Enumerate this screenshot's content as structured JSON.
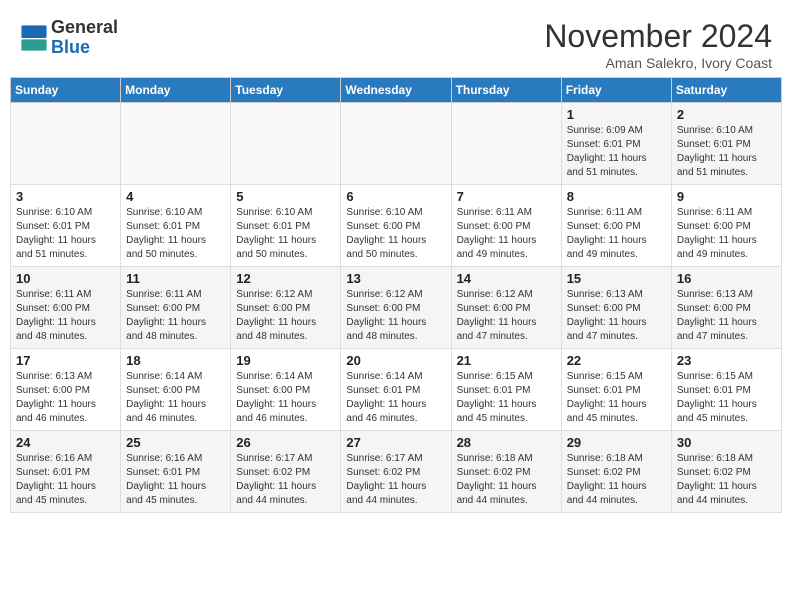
{
  "header": {
    "logo_general": "General",
    "logo_blue": "Blue",
    "month": "November 2024",
    "location": "Aman Salekro, Ivory Coast"
  },
  "days_of_week": [
    "Sunday",
    "Monday",
    "Tuesday",
    "Wednesday",
    "Thursday",
    "Friday",
    "Saturday"
  ],
  "weeks": [
    [
      {
        "day": "",
        "info": ""
      },
      {
        "day": "",
        "info": ""
      },
      {
        "day": "",
        "info": ""
      },
      {
        "day": "",
        "info": ""
      },
      {
        "day": "",
        "info": ""
      },
      {
        "day": "1",
        "info": "Sunrise: 6:09 AM\nSunset: 6:01 PM\nDaylight: 11 hours and 51 minutes."
      },
      {
        "day": "2",
        "info": "Sunrise: 6:10 AM\nSunset: 6:01 PM\nDaylight: 11 hours and 51 minutes."
      }
    ],
    [
      {
        "day": "3",
        "info": "Sunrise: 6:10 AM\nSunset: 6:01 PM\nDaylight: 11 hours and 51 minutes."
      },
      {
        "day": "4",
        "info": "Sunrise: 6:10 AM\nSunset: 6:01 PM\nDaylight: 11 hours and 50 minutes."
      },
      {
        "day": "5",
        "info": "Sunrise: 6:10 AM\nSunset: 6:01 PM\nDaylight: 11 hours and 50 minutes."
      },
      {
        "day": "6",
        "info": "Sunrise: 6:10 AM\nSunset: 6:00 PM\nDaylight: 11 hours and 50 minutes."
      },
      {
        "day": "7",
        "info": "Sunrise: 6:11 AM\nSunset: 6:00 PM\nDaylight: 11 hours and 49 minutes."
      },
      {
        "day": "8",
        "info": "Sunrise: 6:11 AM\nSunset: 6:00 PM\nDaylight: 11 hours and 49 minutes."
      },
      {
        "day": "9",
        "info": "Sunrise: 6:11 AM\nSunset: 6:00 PM\nDaylight: 11 hours and 49 minutes."
      }
    ],
    [
      {
        "day": "10",
        "info": "Sunrise: 6:11 AM\nSunset: 6:00 PM\nDaylight: 11 hours and 48 minutes."
      },
      {
        "day": "11",
        "info": "Sunrise: 6:11 AM\nSunset: 6:00 PM\nDaylight: 11 hours and 48 minutes."
      },
      {
        "day": "12",
        "info": "Sunrise: 6:12 AM\nSunset: 6:00 PM\nDaylight: 11 hours and 48 minutes."
      },
      {
        "day": "13",
        "info": "Sunrise: 6:12 AM\nSunset: 6:00 PM\nDaylight: 11 hours and 48 minutes."
      },
      {
        "day": "14",
        "info": "Sunrise: 6:12 AM\nSunset: 6:00 PM\nDaylight: 11 hours and 47 minutes."
      },
      {
        "day": "15",
        "info": "Sunrise: 6:13 AM\nSunset: 6:00 PM\nDaylight: 11 hours and 47 minutes."
      },
      {
        "day": "16",
        "info": "Sunrise: 6:13 AM\nSunset: 6:00 PM\nDaylight: 11 hours and 47 minutes."
      }
    ],
    [
      {
        "day": "17",
        "info": "Sunrise: 6:13 AM\nSunset: 6:00 PM\nDaylight: 11 hours and 46 minutes."
      },
      {
        "day": "18",
        "info": "Sunrise: 6:14 AM\nSunset: 6:00 PM\nDaylight: 11 hours and 46 minutes."
      },
      {
        "day": "19",
        "info": "Sunrise: 6:14 AM\nSunset: 6:00 PM\nDaylight: 11 hours and 46 minutes."
      },
      {
        "day": "20",
        "info": "Sunrise: 6:14 AM\nSunset: 6:01 PM\nDaylight: 11 hours and 46 minutes."
      },
      {
        "day": "21",
        "info": "Sunrise: 6:15 AM\nSunset: 6:01 PM\nDaylight: 11 hours and 45 minutes."
      },
      {
        "day": "22",
        "info": "Sunrise: 6:15 AM\nSunset: 6:01 PM\nDaylight: 11 hours and 45 minutes."
      },
      {
        "day": "23",
        "info": "Sunrise: 6:15 AM\nSunset: 6:01 PM\nDaylight: 11 hours and 45 minutes."
      }
    ],
    [
      {
        "day": "24",
        "info": "Sunrise: 6:16 AM\nSunset: 6:01 PM\nDaylight: 11 hours and 45 minutes."
      },
      {
        "day": "25",
        "info": "Sunrise: 6:16 AM\nSunset: 6:01 PM\nDaylight: 11 hours and 45 minutes."
      },
      {
        "day": "26",
        "info": "Sunrise: 6:17 AM\nSunset: 6:02 PM\nDaylight: 11 hours and 44 minutes."
      },
      {
        "day": "27",
        "info": "Sunrise: 6:17 AM\nSunset: 6:02 PM\nDaylight: 11 hours and 44 minutes."
      },
      {
        "day": "28",
        "info": "Sunrise: 6:18 AM\nSunset: 6:02 PM\nDaylight: 11 hours and 44 minutes."
      },
      {
        "day": "29",
        "info": "Sunrise: 6:18 AM\nSunset: 6:02 PM\nDaylight: 11 hours and 44 minutes."
      },
      {
        "day": "30",
        "info": "Sunrise: 6:18 AM\nSunset: 6:02 PM\nDaylight: 11 hours and 44 minutes."
      }
    ]
  ]
}
